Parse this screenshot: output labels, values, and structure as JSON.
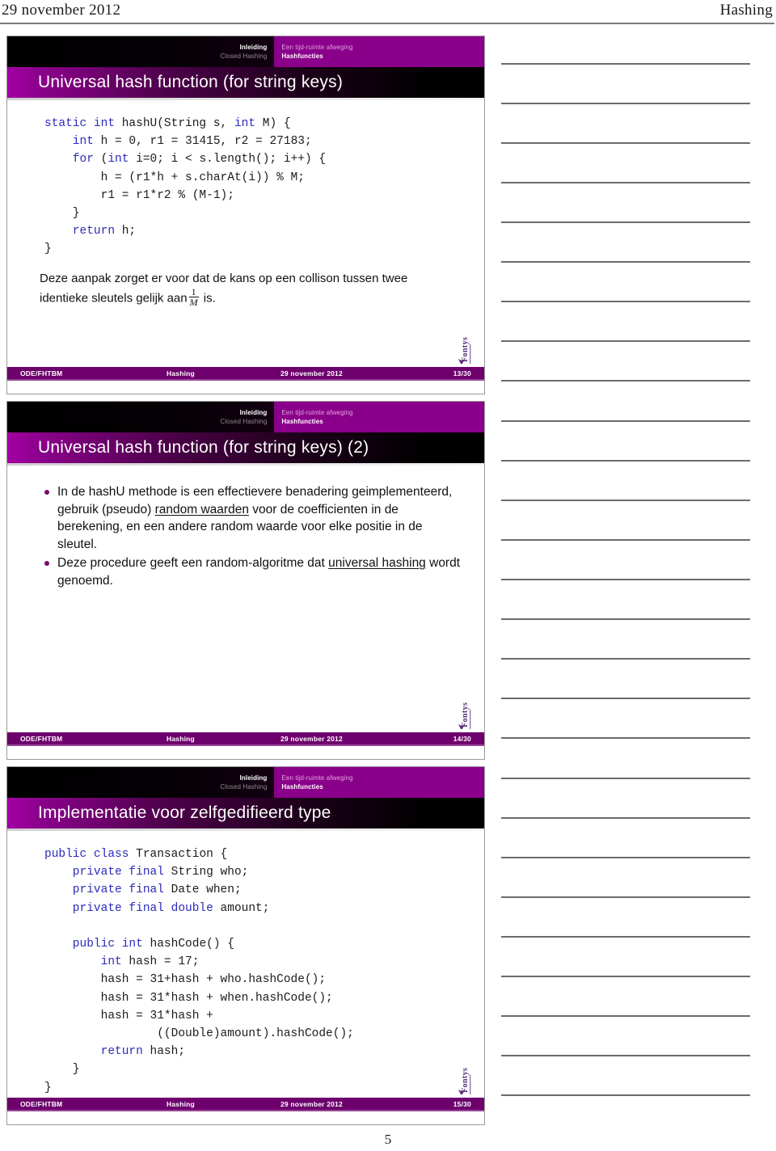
{
  "page": {
    "running_head_left": "29 november 2012",
    "running_head_right": "Hashing",
    "page_number": "5"
  },
  "nav": {
    "left_top": "Inleiding",
    "left_bottom": "Closed Hashing",
    "right_top": "Een tijd-ruimte afweging",
    "right_bottom": "Hashfuncties"
  },
  "footer": {
    "org": "ODE/FHTBM",
    "topic": "Hashing",
    "date": "29 november 2012"
  },
  "colors": {
    "magenta": "#8b008b",
    "footer_purple": "#6e006e",
    "bullet": "#7a0a6e",
    "code_keyword": "#2b2bbb",
    "title_text": "#ffffff"
  },
  "logo": {
    "name": "fontys-logo",
    "text": "Fontys"
  },
  "slides": [
    {
      "title": "Universal hash function (for string keys)",
      "page_label": "13/30",
      "code_lines": [
        [
          {
            "t": "static int ",
            "k": true
          },
          {
            "t": "hashU(String s, ",
            "k": false
          },
          {
            "t": "int ",
            "k": true
          },
          {
            "t": "M) {",
            "k": false
          }
        ],
        [
          {
            "t": "    int ",
            "k": true
          },
          {
            "t": "h = 0, r1 = 31415, r2 = 27183;",
            "k": false
          }
        ],
        [
          {
            "t": "    for ",
            "k": true
          },
          {
            "t": "(",
            "k": false
          },
          {
            "t": "int ",
            "k": true
          },
          {
            "t": "i=0; i < s.length(); i++) {",
            "k": false
          }
        ],
        [
          {
            "t": "        h = (r1*h + s.charAt(i)) % M;",
            "k": false
          }
        ],
        [
          {
            "t": "        r1 = r1*r2 % (M-1);",
            "k": false
          }
        ],
        [
          {
            "t": "    }",
            "k": false
          }
        ],
        [
          {
            "t": "    return ",
            "k": true
          },
          {
            "t": "h;",
            "k": false
          }
        ],
        [
          {
            "t": "}",
            "k": false
          }
        ]
      ],
      "prose_before": "Deze aanpak zorget er voor dat de kans op een collison tussen twee identieke sleutels gelijk aan",
      "prose_fraction_num": "1",
      "prose_fraction_den": "M",
      "prose_after": "is."
    },
    {
      "title": "Universal hash function (for string keys) (2)",
      "page_label": "14/30",
      "bullets": [
        [
          {
            "t": "In de hashU methode is een effectievere benadering geimplementeerd, gebruik (pseudo) ",
            "u": false
          },
          {
            "t": "random waarden",
            "u": true
          },
          {
            "t": " voor de coefficienten in de berekening, en een andere random waarde voor elke positie in de sleutel.",
            "u": false
          }
        ],
        [
          {
            "t": "Deze procedure geeft een random-algoritme dat ",
            "u": false
          },
          {
            "t": "universal hashing",
            "u": true
          },
          {
            "t": " wordt genoemd.",
            "u": false
          }
        ]
      ]
    },
    {
      "title": "Implementatie voor zelfgedifieerd type",
      "page_label": "15/30",
      "code_lines": [
        [
          {
            "t": "public class ",
            "k": true
          },
          {
            "t": "Transaction {",
            "k": false
          }
        ],
        [
          {
            "t": "    private final ",
            "k": true
          },
          {
            "t": "String who;",
            "k": false
          }
        ],
        [
          {
            "t": "    private final ",
            "k": true
          },
          {
            "t": "Date when;",
            "k": false
          }
        ],
        [
          {
            "t": "    private final double ",
            "k": true
          },
          {
            "t": "amount;",
            "k": false
          }
        ],
        [
          {
            "t": "",
            "k": false
          }
        ],
        [
          {
            "t": "    public int ",
            "k": true
          },
          {
            "t": "hashCode() {",
            "k": false
          }
        ],
        [
          {
            "t": "        int ",
            "k": true
          },
          {
            "t": "hash = 17;",
            "k": false
          }
        ],
        [
          {
            "t": "        hash = 31+hash + who.hashCode();",
            "k": false
          }
        ],
        [
          {
            "t": "        hash = 31*hash + when.hashCode();",
            "k": false
          }
        ],
        [
          {
            "t": "        hash = 31*hash +",
            "k": false
          }
        ],
        [
          {
            "t": "                ((Double)amount).hashCode();",
            "k": false
          }
        ],
        [
          {
            "t": "        return ",
            "k": true
          },
          {
            "t": "hash;",
            "k": false
          }
        ],
        [
          {
            "t": "    }",
            "k": false
          }
        ],
        [
          {
            "t": "}",
            "k": false
          }
        ]
      ]
    }
  ]
}
